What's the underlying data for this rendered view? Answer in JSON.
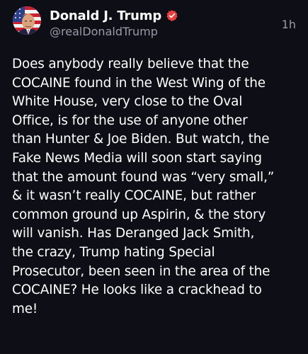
{
  "post": {
    "author": {
      "display_name": "Donald J. Trump",
      "handle": "@realDonaldTrump",
      "verified": true,
      "verified_icon": "verified-badge-icon",
      "avatar": "profile-avatar"
    },
    "timestamp": "1h",
    "body_lines": [
      "Does anybody really believe that the",
      "COCAINE found in the West Wing of the",
      "White House, very close to the Oval",
      "Office, is for the use of anyone other",
      "than Hunter & Joe Biden. But watch, the",
      "Fake News Media will soon start saying",
      "that the amount found was “very small,”",
      "& it wasn’t really COCAINE, but rather",
      "common ground up Aspirin, & the story",
      "will vanish. Has Deranged Jack Smith,",
      "the crazy, Trump hating Special",
      "Prosecutor, been seen in the area of the",
      "COCAINE? He looks like a crackhead to",
      "me!"
    ]
  },
  "colors": {
    "background": "#0e0e16",
    "text_primary": "#ffffff",
    "text_secondary": "#9a9aa8",
    "verified_badge": "#e8403f"
  }
}
